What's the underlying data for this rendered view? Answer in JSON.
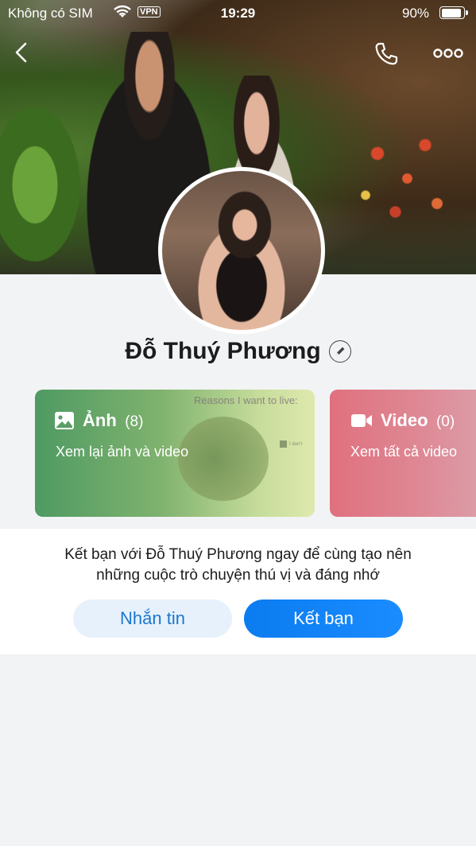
{
  "status_bar": {
    "carrier": "Không có SIM",
    "vpn": "VPN",
    "time": "19:29",
    "battery": "90%",
    "battery_level": 0.9
  },
  "nav": {
    "icons": [
      "back-icon",
      "phone-icon",
      "more-icon"
    ]
  },
  "profile": {
    "name": "Đỗ Thuý Phương"
  },
  "media": {
    "photos": {
      "title": "Ảnh",
      "count": "(8)",
      "subtitle": "Xem lại ảnh và video",
      "thumb_caption": "Reasons I want to live:",
      "thumb_legend": "I don't",
      "color": "#5a9e65"
    },
    "videos": {
      "title": "Video",
      "count": "(0)",
      "subtitle": "Xem tất cả video",
      "color": "#e0707e"
    }
  },
  "friend": {
    "message_line1": "Kết bạn với Đỗ Thuý Phương ngay để cùng tạo nên",
    "message_line2": "những cuộc trò chuyện thú vị và đáng nhớ",
    "message_button": "Nhắn tin",
    "add_friend_button": "Kết bạn",
    "accent": "#0a7cf0"
  }
}
